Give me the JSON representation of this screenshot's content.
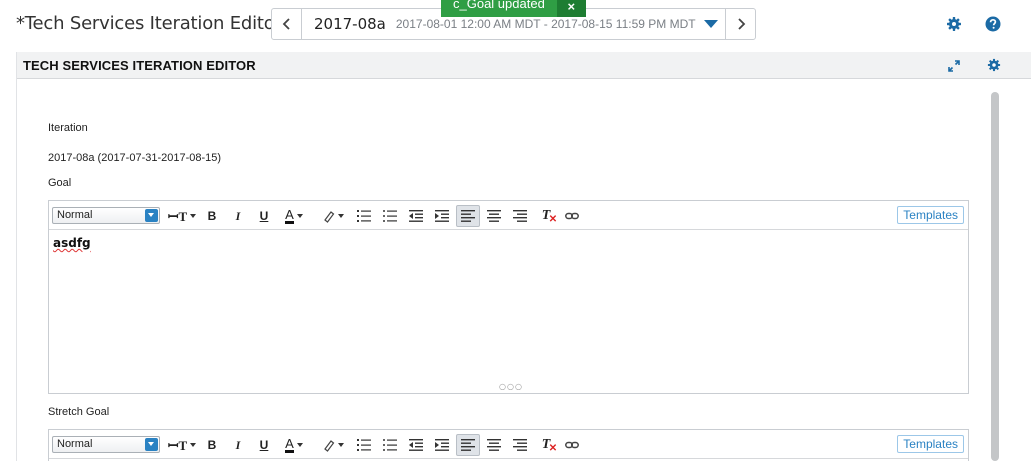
{
  "header": {
    "title": "*Tech Services Iteration Editor",
    "iteration": {
      "name": "2017-08a",
      "range": "2017-08-01 12:00 AM MDT - 2017-08-15 11:59 PM MDT",
      "prev_icon": "chevron-left-icon",
      "next_icon": "chevron-right-icon"
    },
    "icons": [
      "gear-icon",
      "help-icon"
    ]
  },
  "toast": {
    "message": "c_Goal updated",
    "close_label": "×"
  },
  "panel": {
    "title": "TECH SERVICES ITERATION EDITOR",
    "icons": [
      "expand-icon",
      "gear-icon"
    ]
  },
  "form": {
    "iteration_label": "Iteration",
    "iteration_value": "2017-08a (2017-07-31-2017-08-15)",
    "goal_label": "Goal",
    "goal_text": "asdfg",
    "stretch_label": "Stretch Goal"
  },
  "editor_toolbar": {
    "format_value": "Normal",
    "templates_label": "Templates",
    "buttons": [
      "font-size",
      "bold",
      "italic",
      "underline",
      "text-color",
      "highlight",
      "ordered-list",
      "bullet-list",
      "outdent",
      "indent",
      "align-left",
      "align-center",
      "align-right",
      "clear-format",
      "link"
    ],
    "bold_glyph": "B",
    "italic_glyph": "I",
    "underline_glyph": "U",
    "text_color_glyph": "A",
    "clear_glyph": "T"
  },
  "colors": {
    "accent": "#1b6aa5",
    "toast_bg": "#2f9e44",
    "toast_close_bg": "#1e7d32",
    "panel_header_bg": "#f1f2f3"
  }
}
